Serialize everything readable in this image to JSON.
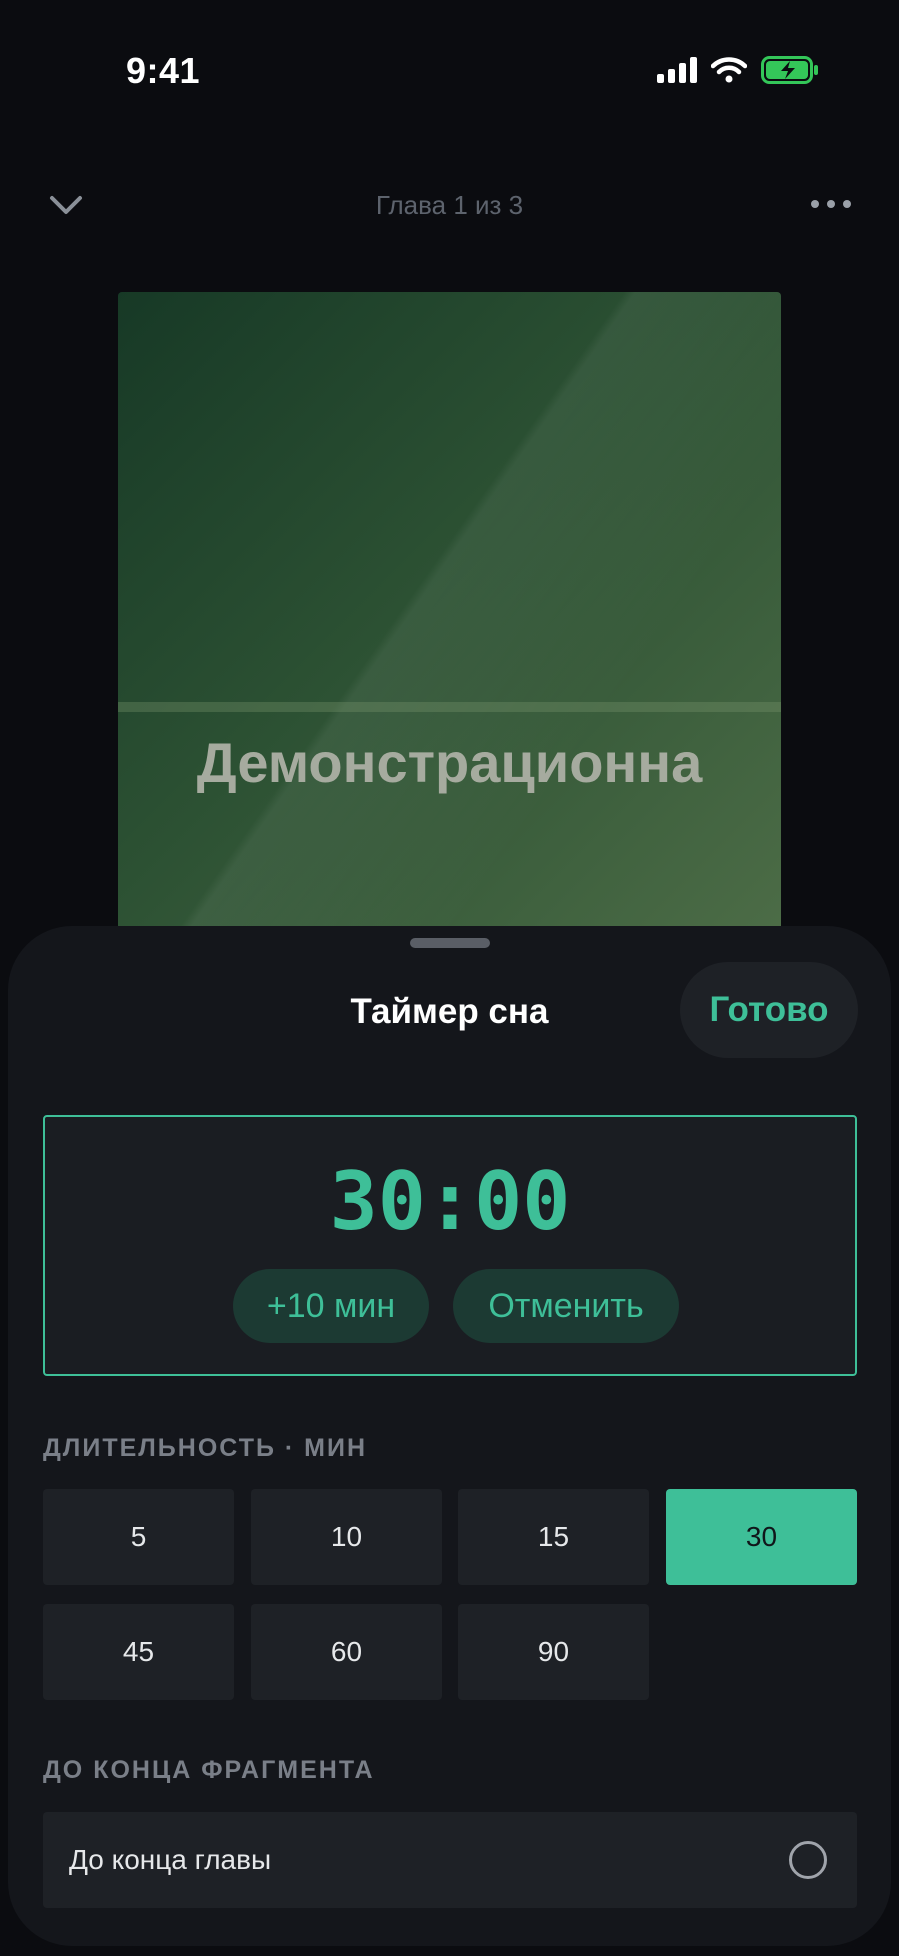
{
  "status_bar": {
    "time": "9:41",
    "icons": [
      "signal-icon",
      "wifi-icon",
      "battery-charging-icon"
    ],
    "battery_color": "#34c759"
  },
  "nav": {
    "title": "Глава 1 из 3",
    "left_icon": "chevron-down-icon",
    "right_icon": "more-icon"
  },
  "cover": {
    "title": "Демонстрационна"
  },
  "sheet": {
    "title": "Таймер сна",
    "done_label": "Готово",
    "timer": {
      "value": "30:00",
      "add_label": "+10 мин",
      "cancel_label": "Отменить"
    },
    "duration_label": "ДЛИТЕЛЬНОСТЬ · МИН",
    "durations": [
      "5",
      "10",
      "15",
      "30",
      "45",
      "60",
      "90"
    ],
    "selected_duration": "30",
    "fragment_label": "ДО КОНЦА ФРАГМЕНТА",
    "fragment_option": {
      "label": "До конца главы",
      "selected": false
    }
  },
  "colors": {
    "accent": "#3ebf98",
    "background": "#0b0c10",
    "sheet": "#14161b",
    "surface": "#1e2126"
  }
}
